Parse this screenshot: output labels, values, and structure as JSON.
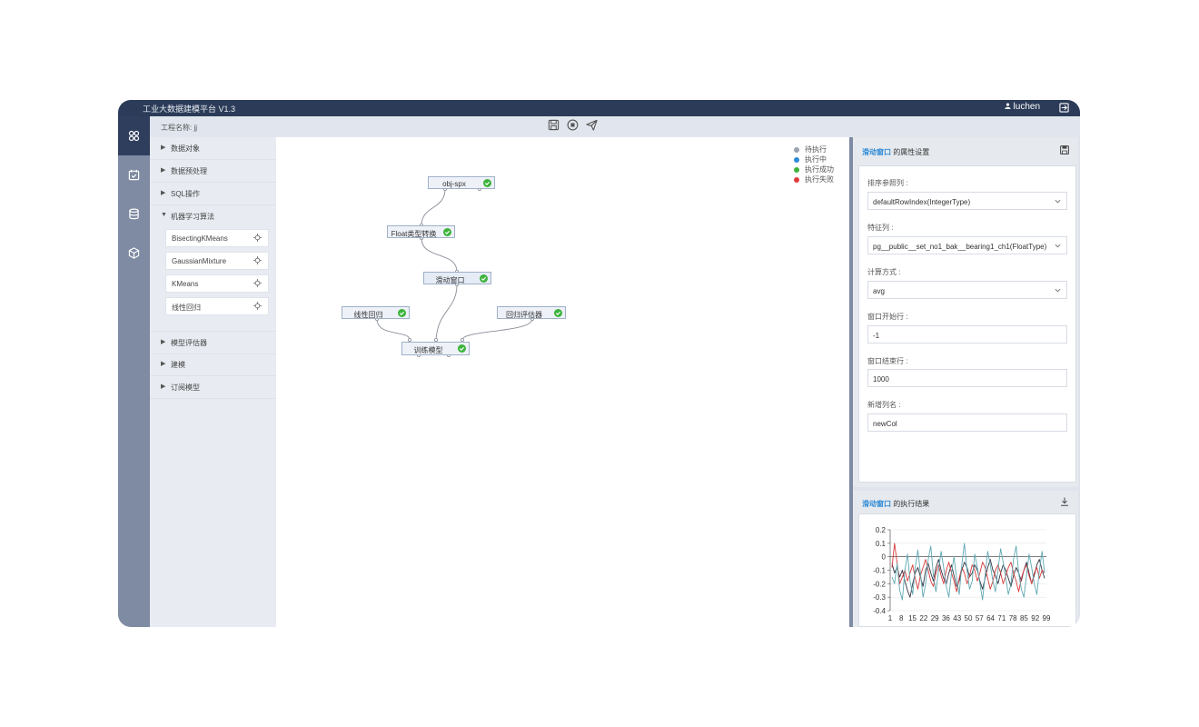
{
  "app": {
    "title": "工业大数据建模平台   V1.3",
    "user": "luchen"
  },
  "project": {
    "label": "工程名称: jj"
  },
  "tree": {
    "categories": [
      {
        "label": "数据对象",
        "arrow": "▶"
      },
      {
        "label": "数据预处理",
        "arrow": "▶"
      },
      {
        "label": "SQL操作",
        "arrow": "▶"
      },
      {
        "label": "机器学习算法",
        "arrow": "▼"
      },
      {
        "label": "模型评估器",
        "arrow": "▶"
      },
      {
        "label": "建模",
        "arrow": "▶"
      },
      {
        "label": "订阅模型",
        "arrow": "▶"
      }
    ],
    "ml_items": [
      "BisectingKMeans",
      "GaussianMixture",
      "KMeans",
      "线性回归"
    ]
  },
  "legend": [
    {
      "label": "待执行",
      "color": "#9aa3b0"
    },
    {
      "label": "执行中",
      "color": "#2d8ad7"
    },
    {
      "label": "执行成功",
      "color": "#3cb33c"
    },
    {
      "label": "执行失败",
      "color": "#e03b3b"
    }
  ],
  "nodes": [
    "obj-spx",
    "Float类型转换",
    "滑动窗口",
    "线性回归",
    "回归评估器",
    "训练模型"
  ],
  "properties": {
    "component": "滑动窗口",
    "header_suffix": " 的属性设置",
    "fields": [
      {
        "label": "排序参照列 :",
        "value": "defaultRowIndex(IntegerType)",
        "select": true
      },
      {
        "label": "特征列 :",
        "value": "pg__public__set_no1_bak__bearing1_ch1(FloatType)",
        "select": true
      },
      {
        "label": "计算方式 :",
        "value": "avg",
        "select": true
      },
      {
        "label": "窗口开始行 :",
        "value": "-1",
        "select": false
      },
      {
        "label": "窗口结束行 :",
        "value": "1000",
        "select": false
      },
      {
        "label": "新增列名 :",
        "value": "newCol",
        "select": false
      }
    ]
  },
  "result": {
    "component": "滑动窗口",
    "header_suffix": " 的执行结果"
  },
  "chart_data": {
    "type": "line",
    "ylim": [
      -0.4,
      0.2
    ],
    "yticks": [
      "0.2",
      "0.1",
      "0",
      "-0.1",
      "-0.2",
      "-0.3",
      "-0.4"
    ],
    "xticks": [
      "1",
      "8",
      "15",
      "22",
      "29",
      "36",
      "43",
      "50",
      "57",
      "64",
      "71",
      "78",
      "85",
      "92",
      "99"
    ],
    "series": [
      {
        "color": "#333745",
        "values": [
          -0.05,
          -0.12,
          -0.08,
          -0.15,
          -0.1,
          -0.18,
          -0.25,
          -0.3,
          -0.2,
          -0.12,
          -0.08,
          -0.15,
          -0.22,
          -0.1,
          -0.05,
          -0.12,
          -0.18,
          -0.08,
          -0.02,
          -0.1,
          -0.16,
          -0.2,
          -0.12,
          -0.06,
          -0.14,
          -0.22,
          -0.18,
          -0.1,
          -0.04,
          -0.08,
          -0.15,
          -0.12,
          -0.06,
          -0.1,
          -0.18,
          -0.24,
          -0.16,
          -0.08,
          -0.02,
          -0.1,
          -0.14,
          -0.2,
          -0.12,
          -0.06,
          -0.1,
          -0.16,
          -0.22,
          -0.14,
          -0.08,
          -0.12,
          -0.18,
          -0.1,
          -0.04,
          -0.12,
          -0.2,
          -0.14,
          -0.06,
          -0.02,
          -0.1,
          -0.16
        ]
      },
      {
        "color": "#d93a3a",
        "values": [
          -0.08,
          0.1,
          -0.05,
          -0.2,
          -0.15,
          -0.1,
          -0.18,
          -0.12,
          -0.06,
          -0.16,
          -0.24,
          -0.14,
          -0.08,
          -0.02,
          -0.1,
          -0.18,
          -0.22,
          -0.12,
          -0.06,
          -0.14,
          -0.2,
          -0.1,
          -0.04,
          -0.12,
          -0.18,
          -0.26,
          -0.16,
          -0.08,
          -0.12,
          -0.2,
          -0.14,
          -0.06,
          -0.1,
          -0.18,
          -0.12,
          -0.04,
          -0.08,
          -0.16,
          -0.24,
          -0.18,
          -0.1,
          -0.06,
          -0.12,
          -0.2,
          -0.14,
          -0.08,
          -0.04,
          -0.12,
          -0.18,
          -0.26,
          -0.16,
          -0.1,
          -0.06,
          -0.14,
          -0.2,
          -0.12,
          -0.08,
          -0.16,
          -0.1,
          -0.12
        ]
      },
      {
        "color": "#5fa8b3",
        "values": [
          -0.15,
          -0.2,
          -0.05,
          -0.25,
          -0.32,
          -0.1,
          0.02,
          -0.18,
          -0.28,
          -0.08,
          0.05,
          -0.12,
          -0.3,
          -0.2,
          -0.02,
          0.08,
          -0.14,
          -0.26,
          -0.1,
          0.04,
          -0.08,
          -0.22,
          -0.3,
          -0.12,
          0.0,
          -0.16,
          -0.28,
          -0.06,
          0.1,
          -0.1,
          -0.24,
          -0.18,
          0.02,
          -0.08,
          -0.2,
          -0.32,
          -0.14,
          0.04,
          -0.06,
          -0.18,
          -0.26,
          -0.1,
          0.06,
          -0.04,
          -0.16,
          -0.28,
          -0.2,
          -0.02,
          0.08,
          -0.12,
          -0.24,
          -0.3,
          -0.14,
          0.02,
          -0.08,
          -0.2,
          -0.28,
          -0.1,
          0.04,
          -0.12
        ]
      }
    ]
  }
}
